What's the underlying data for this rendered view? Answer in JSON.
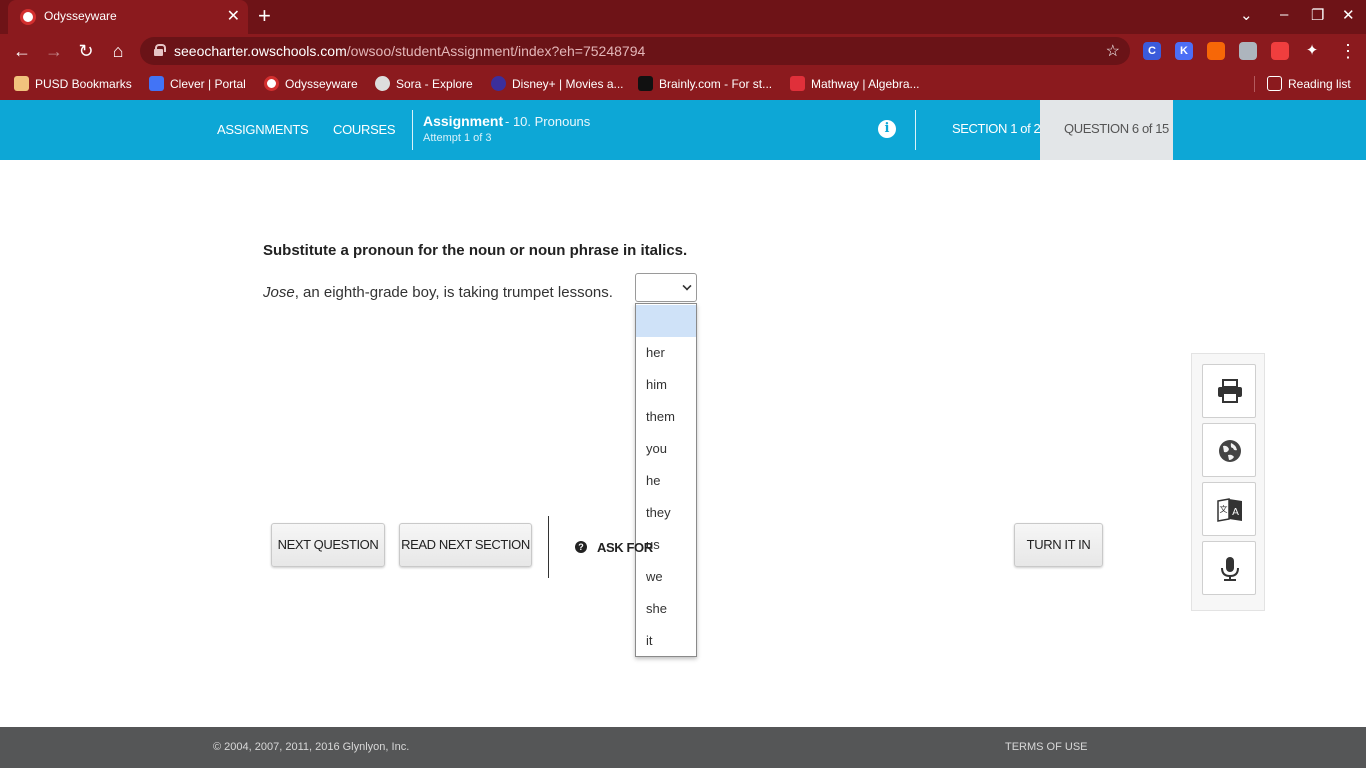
{
  "browser": {
    "tab_title": "Odysseyware",
    "url_host": "seeocharter.owschools.com",
    "url_path": "/owsoo/studentAssignment/index?eh=75248794",
    "bookmarks": [
      {
        "label": "PUSD Bookmarks",
        "icon": "folder-icon"
      },
      {
        "label": "Clever | Portal",
        "icon": "clever-icon"
      },
      {
        "label": "Odysseyware",
        "icon": "odysseyware-icon"
      },
      {
        "label": "Sora - Explore",
        "icon": "sora-icon"
      },
      {
        "label": "Disney+ | Movies a...",
        "icon": "disney-icon"
      },
      {
        "label": "Brainly.com - For st...",
        "icon": "brainly-icon"
      },
      {
        "label": "Mathway | Algebra...",
        "icon": "mathway-icon"
      }
    ],
    "reading_list": "Reading list",
    "extensions": [
      {
        "letter": "C",
        "color": "#3b5bdb"
      },
      {
        "letter": "K",
        "color": "#4c6ef5"
      },
      {
        "letter": "",
        "color": "#f76707"
      },
      {
        "letter": "",
        "color": "#adb5bd"
      },
      {
        "letter": "",
        "color": "#f03e3e"
      }
    ]
  },
  "header": {
    "nav_assignments": "ASSIGNMENTS",
    "nav_courses": "COURSES",
    "assignment_label": "Assignment",
    "assignment_name": "- 10. Pronouns",
    "attempt": "Attempt 1 of 3",
    "section": "SECTION 1 of 2",
    "question": "QUESTION 6 of 15"
  },
  "question": {
    "prompt": "Substitute a pronoun for the noun or noun phrase in italics.",
    "sentence_italic": "Jose",
    "sentence_rest": ", an eighth-grade boy, is taking trumpet lessons.",
    "options": [
      "",
      "her",
      "him",
      "them",
      "you",
      "he",
      "they",
      "us",
      "we",
      "she",
      "it"
    ]
  },
  "buttons": {
    "next_question": "NEXT QUESTION",
    "read_next_section": "READ NEXT SECTION",
    "ask_for_help": "ASK FOR",
    "turn_it_in": "TURN IT IN"
  },
  "footer": {
    "copyright": "© 2004, 2007, 2011, 2016 Glynlyon, Inc.",
    "terms": "TERMS OF USE"
  },
  "colors": {
    "brand_blue": "#0da7d6",
    "browser_red": "#8b1a1e",
    "footer_gray": "#555657"
  }
}
